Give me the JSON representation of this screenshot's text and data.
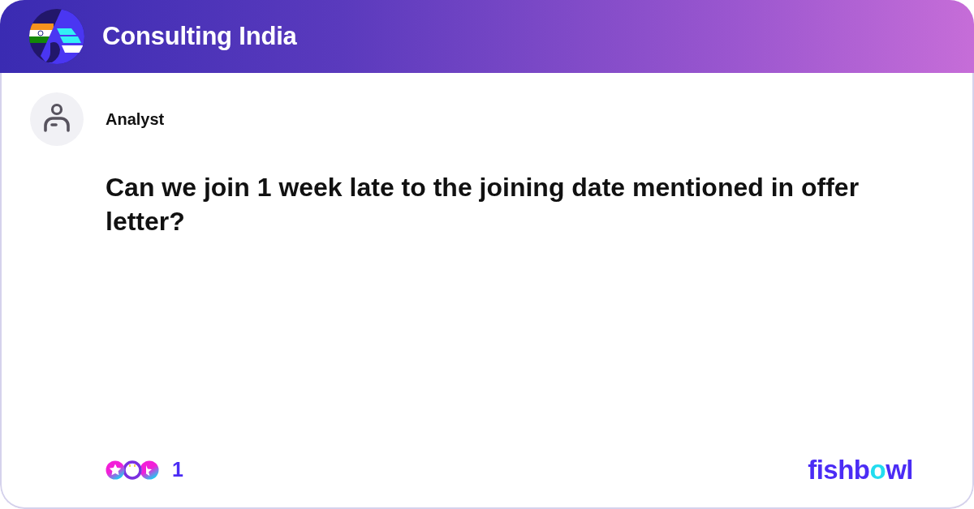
{
  "header": {
    "title": "Consulting India"
  },
  "post": {
    "author": "Analyst",
    "text": "Can we join 1 week late to the joining date mentioned in offer letter?"
  },
  "footer": {
    "reaction_count": "1",
    "brand_logo": [
      {
        "text": "fishb",
        "color": "#4b2cf5"
      },
      {
        "text": "o",
        "color": "#22dcef"
      },
      {
        "text": "wl",
        "color": "#4b2cf5"
      }
    ]
  }
}
